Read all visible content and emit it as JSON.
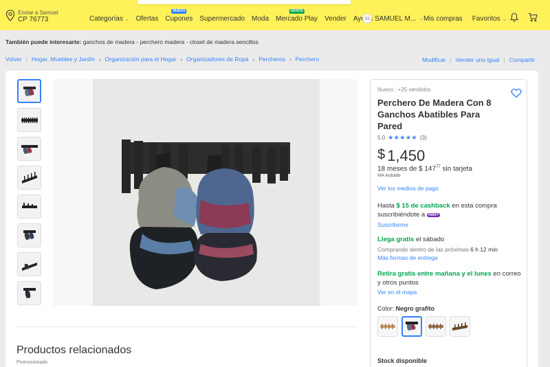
{
  "header": {
    "location_line1": "Enviar a Samuel",
    "location_line2": "CP 76773",
    "nav": [
      {
        "label": "Categorías",
        "caret": "⌄"
      },
      {
        "label": "Ofertas"
      },
      {
        "label": "Cupones",
        "badge": "NUEVO"
      },
      {
        "label": "Supermercado"
      },
      {
        "label": "Moda"
      },
      {
        "label": "Mercado Play",
        "badge": "GRATIS"
      },
      {
        "label": "Vender"
      },
      {
        "label": "Ayuda"
      }
    ],
    "user_initials": "SS",
    "user_name": "SAMUEL M...",
    "my_purchases": "Mis compras",
    "favorites": "Favoritos",
    "colors": {
      "bar": "#fff159",
      "accent": "#3483fa",
      "success": "#00a650"
    }
  },
  "suggest": {
    "label": "También puede interesarte:",
    "text": "ganchos de madera - perchero madera - closet de madera sencillos"
  },
  "breadcrumb": {
    "back": "Volver",
    "items": [
      "Hogar, Muebles y Jardín",
      "Organización para el Hogar",
      "Organizadores de Ropa",
      "Percheros",
      "Perchero"
    ]
  },
  "actions": {
    "modify": "Modificar",
    "sell_same": "Vender uno igual",
    "share": "Compartir"
  },
  "gallery": {
    "thumbnail_count": 8,
    "selected_index": 0
  },
  "related": {
    "title": "Productos relacionados",
    "promoted": "Promocionado"
  },
  "product": {
    "condition": "Nuevo",
    "sold": "+25 vendidos",
    "title": "Perchero De Madera Con 8 Ganchos Abatibles Para Pared",
    "rating_value": "5.0",
    "rating_stars": "★★★★★",
    "rating_count": "(3)",
    "currency": "$",
    "price": "1,450",
    "installments_prefix": "18 meses de $ 147",
    "installments_cents": "77",
    "installments_suffix": " sin tarjeta",
    "tax": "IVA incluido",
    "payment_link": "Ver los medios de pago",
    "cashback_prefix": "Hasta ",
    "cashback_amount": "$ 15 de cashback",
    "cashback_suffix": " en esta compra suscribiéndote a ",
    "meli_badge": "meli+",
    "subscribe": "Suscribirme",
    "delivery_green": "Llega gratis",
    "delivery_rest": " el sábado",
    "buy_within_prefix": "Comprando dentro de las próximas ",
    "buy_within_time": "6 h 12 min",
    "more_delivery": "Más formas de entrega",
    "pickup_green": "Retira gratis entre mañana y el lunes",
    "pickup_rest": " en correo y otros puntos",
    "map_link": "Ver en el mapa",
    "color_label": "Color: ",
    "color_value": "Negro grafito",
    "swatches": [
      "light-wood",
      "black",
      "natural-wood",
      "dark-wood"
    ],
    "selected_swatch": 1,
    "stock": "Stock disponible"
  }
}
